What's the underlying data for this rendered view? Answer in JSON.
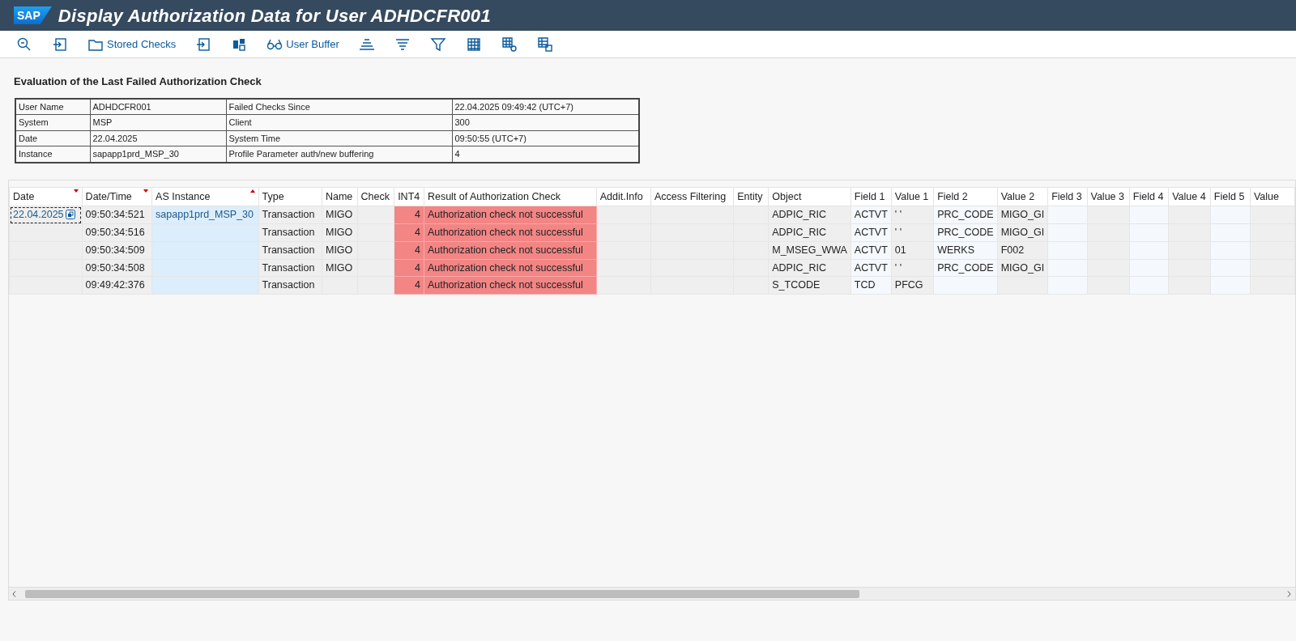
{
  "window": {
    "logo": "SAP",
    "title": "Display Authorization Data for User ADHDCFR001"
  },
  "toolbar": [
    {
      "kind": "icon"
    },
    {
      "kind": "icon"
    },
    {
      "kind": "labeled",
      "label": "Stored Checks"
    },
    {
      "kind": "icon"
    },
    {
      "kind": "icon"
    },
    {
      "kind": "labeled",
      "label": "User Buffer"
    },
    {
      "kind": "icon"
    },
    {
      "kind": "icon"
    },
    {
      "kind": "icon"
    },
    {
      "kind": "icon"
    },
    {
      "kind": "icon"
    },
    {
      "kind": "icon"
    }
  ],
  "summary": {
    "heading": "Evaluation of the Last Failed Authorization Check",
    "rows": [
      [
        "User Name",
        "ADHDCFR001",
        "Failed Checks Since",
        "22.04.2025 09:49:42 (UTC+7)"
      ],
      [
        "System",
        "MSP",
        "Client",
        "300"
      ],
      [
        "Date",
        "22.04.2025",
        "System Time",
        "09:50:55 (UTC+7)"
      ],
      [
        "Instance",
        "sapapp1prd_MSP_30",
        "Profile Parameter auth/new buffering",
        "4"
      ]
    ]
  },
  "table": {
    "columns": [
      {
        "label": "Date",
        "kind": "key",
        "sort_ascending": false,
        "sort_descending": true
      },
      {
        "label": "Date/Time",
        "kind": "plain",
        "sort_ascending": false,
        "sort_descending": true
      },
      {
        "label": "AS Instance",
        "kind": "key",
        "sort_ascending": true,
        "sort_descending": false
      },
      {
        "label": "Type",
        "kind": "plain",
        "sort_ascending": false,
        "sort_descending": false
      },
      {
        "label": "Name",
        "kind": "plain",
        "sort_ascending": false,
        "sort_descending": false
      },
      {
        "label": "Check",
        "kind": "plain",
        "sort_ascending": false,
        "sort_descending": false
      },
      {
        "label": "INT4",
        "kind": "alert-number",
        "sort_ascending": false,
        "sort_descending": false
      },
      {
        "label": "Result of Authorization Check",
        "kind": "alert",
        "sort_ascending": false,
        "sort_descending": false
      },
      {
        "label": "Addit.Info",
        "kind": "plain",
        "sort_ascending": false,
        "sort_descending": false
      },
      {
        "label": "Access Filtering",
        "kind": "plain",
        "sort_ascending": false,
        "sort_descending": false
      },
      {
        "label": "Entity",
        "kind": "plain",
        "sort_ascending": false,
        "sort_descending": false
      },
      {
        "label": "Object",
        "kind": "plain",
        "sort_ascending": false,
        "sort_descending": false
      },
      {
        "label": "Field 1",
        "kind": "field",
        "sort_ascending": false,
        "sort_descending": false
      },
      {
        "label": "Value 1",
        "kind": "plain",
        "sort_ascending": false,
        "sort_descending": false
      },
      {
        "label": "Field 2",
        "kind": "field",
        "sort_ascending": false,
        "sort_descending": false
      },
      {
        "label": "Value 2",
        "kind": "plain",
        "sort_ascending": false,
        "sort_descending": false
      },
      {
        "label": "Field 3",
        "kind": "field",
        "sort_ascending": false,
        "sort_descending": false
      },
      {
        "label": "Value 3",
        "kind": "plain",
        "sort_ascending": false,
        "sort_descending": false
      },
      {
        "label": "Field 4",
        "kind": "field",
        "sort_ascending": false,
        "sort_descending": false
      },
      {
        "label": "Value 4",
        "kind": "plain",
        "sort_ascending": false,
        "sort_descending": false
      },
      {
        "label": "Field 5",
        "kind": "field",
        "sort_ascending": false,
        "sort_descending": false
      },
      {
        "label": "Value",
        "kind": "plain",
        "sort_ascending": false,
        "sort_descending": false
      }
    ],
    "rows": [
      {
        "focused": true,
        "cells": [
          "22.04.2025",
          "09:50:34:521",
          "sapapp1prd_MSP_30",
          "Transaction",
          "MIGO",
          null,
          "4",
          "Authorization check not successful",
          null,
          null,
          null,
          "ADPIC_RIC",
          "ACTVT",
          "' '",
          "PRC_CODE",
          "MIGO_GI",
          null,
          null,
          null,
          null,
          null,
          null
        ]
      },
      {
        "focused": false,
        "cells": [
          null,
          "09:50:34:516",
          null,
          "Transaction",
          "MIGO",
          null,
          "4",
          "Authorization check not successful",
          null,
          null,
          null,
          "ADPIC_RIC",
          "ACTVT",
          "' '",
          "PRC_CODE",
          "MIGO_GI",
          null,
          null,
          null,
          null,
          null,
          null
        ]
      },
      {
        "focused": false,
        "cells": [
          null,
          "09:50:34:509",
          null,
          "Transaction",
          "MIGO",
          null,
          "4",
          "Authorization check not successful",
          null,
          null,
          null,
          "M_MSEG_WWA",
          "ACTVT",
          "01",
          "WERKS",
          "F002",
          null,
          null,
          null,
          null,
          null,
          null
        ]
      },
      {
        "focused": false,
        "cells": [
          null,
          "09:50:34:508",
          null,
          "Transaction",
          "MIGO",
          null,
          "4",
          "Authorization check not successful",
          null,
          null,
          null,
          "ADPIC_RIC",
          "ACTVT",
          "' '",
          "PRC_CODE",
          "MIGO_GI",
          null,
          null,
          null,
          null,
          null,
          null
        ]
      },
      {
        "focused": false,
        "cells": [
          null,
          "09:49:42:376",
          null,
          "Transaction",
          null,
          null,
          "4",
          "Authorization check not successful",
          null,
          null,
          null,
          "S_TCODE",
          "TCD",
          "PFCG",
          null,
          null,
          null,
          null,
          null,
          null,
          null,
          null
        ]
      }
    ]
  }
}
